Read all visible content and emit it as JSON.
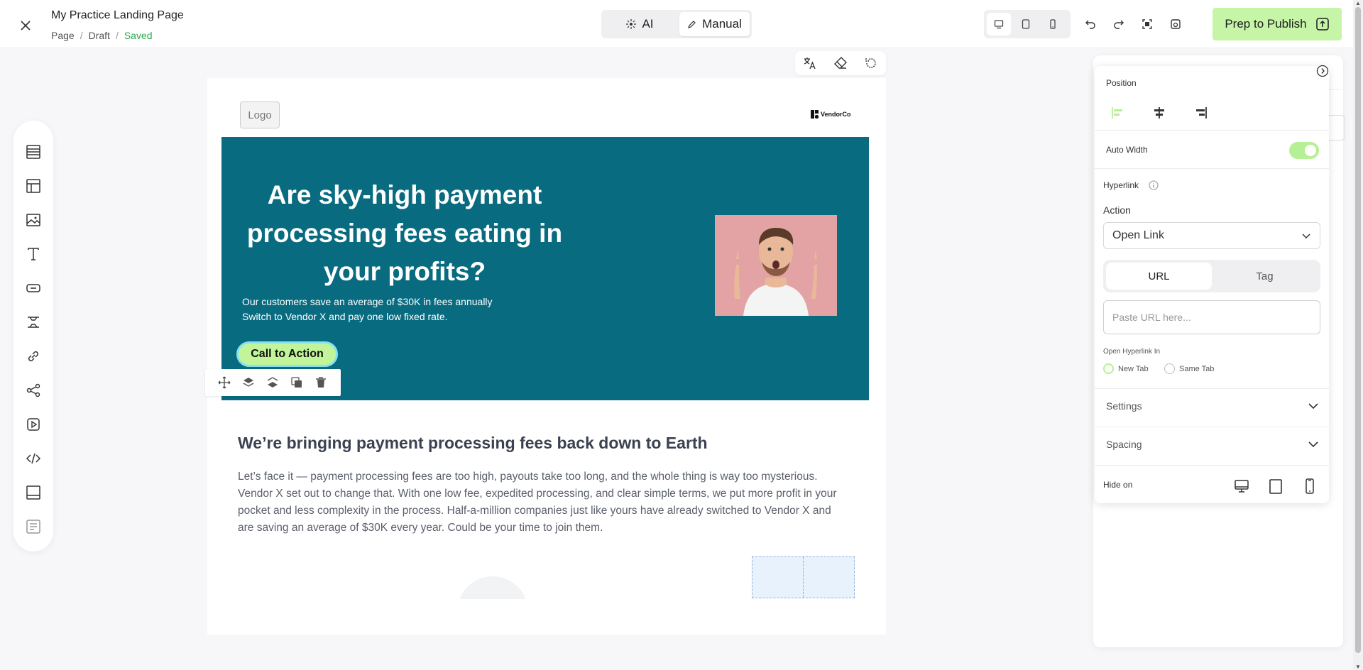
{
  "header": {
    "title": "My Practice Landing Page",
    "breadcrumb": [
      "Page",
      "Draft",
      "Saved"
    ],
    "mode_ai": "AI",
    "mode_manual": "Manual",
    "publish_label": "Prep to Publish"
  },
  "canvas": {
    "logo_text": "Logo",
    "vendor_text": "VendorCo",
    "hero_title": "Are sky-high payment processing fees eating in your profits?",
    "hero_sub_1": "Our customers save an average of $30K in fees annually",
    "hero_sub_2": "Switch to Vendor X and pay one low fixed rate.",
    "cta_label": "Call to Action",
    "section_heading": "We’re bringing payment processing fees back down to Earth",
    "section_body": "Let’s face it — payment processing fees are too high, payouts take too long, and the whole thing is way too mysterious. Vendor X set out to change that. With one low fee, expedited processing, and clear simple terms, we put more profit in your pocket and less complexity in the process. Half-a-million companies just like yours have already switched to Vendor X and are saving an average of $30K every year. Could be your time to join them."
  },
  "panel": {
    "position_label": "Position",
    "auto_width_label": "Auto Width",
    "auto_width_on": true,
    "hyperlink_label": "Hyperlink",
    "action_label": "Action",
    "action_value": "Open Link",
    "tab_url": "URL",
    "tab_tag": "Tag",
    "url_placeholder": "Paste URL here...",
    "open_in_label": "Open Hyperlink In",
    "radio_new_tab": "New Tab",
    "radio_same_tab": "Same Tab",
    "settings_label": "Settings",
    "spacing_label": "Spacing",
    "hide_on_label": "Hide on"
  },
  "colors": {
    "hero_bg": "#086b80",
    "cta_bg": "#c2f59a",
    "publish_bg": "#c7f5a8",
    "saved_text": "#2fa84f",
    "toggle_on": "#b6f096"
  }
}
